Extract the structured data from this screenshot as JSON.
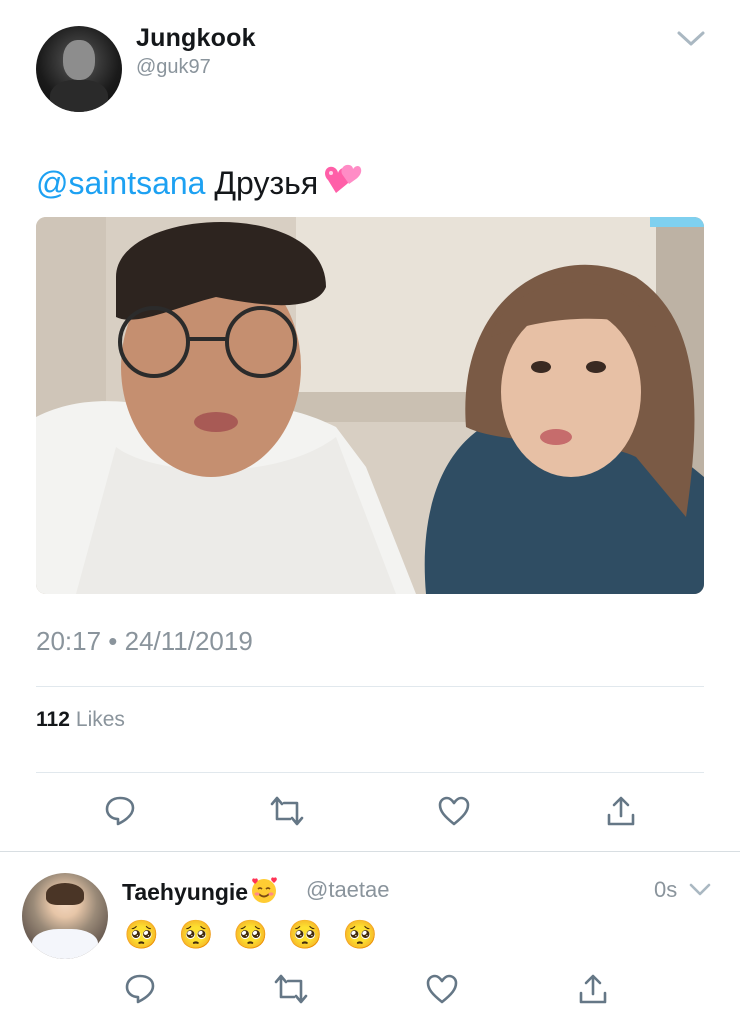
{
  "tweet": {
    "author_name": "Jungkook",
    "author_handle": "@guk97",
    "mention": "@saintsana",
    "text": "Друзья",
    "text_emoji": "heart-emoji",
    "timestamp": "20:17 • 24/11/2019",
    "likes_count": "112",
    "likes_label": "Likes",
    "actions": [
      "reply-icon",
      "retweet-icon",
      "like-icon",
      "share-icon"
    ]
  },
  "reply": {
    "author_name": "Taehyungie",
    "name_emoji": "smiling-face-with-hearts-emoji",
    "author_handle": "@taetae",
    "time": "0s",
    "text": "🥺 🥺 🥺 🥺 🥺",
    "actions": [
      "reply-icon",
      "retweet-icon",
      "like-icon",
      "share-icon"
    ]
  },
  "colors": {
    "link_blue": "#1da1f2",
    "text_primary": "#14171a",
    "text_secondary": "#8a949c",
    "divider": "#e1e8ed",
    "icon_gray": "#657786"
  }
}
